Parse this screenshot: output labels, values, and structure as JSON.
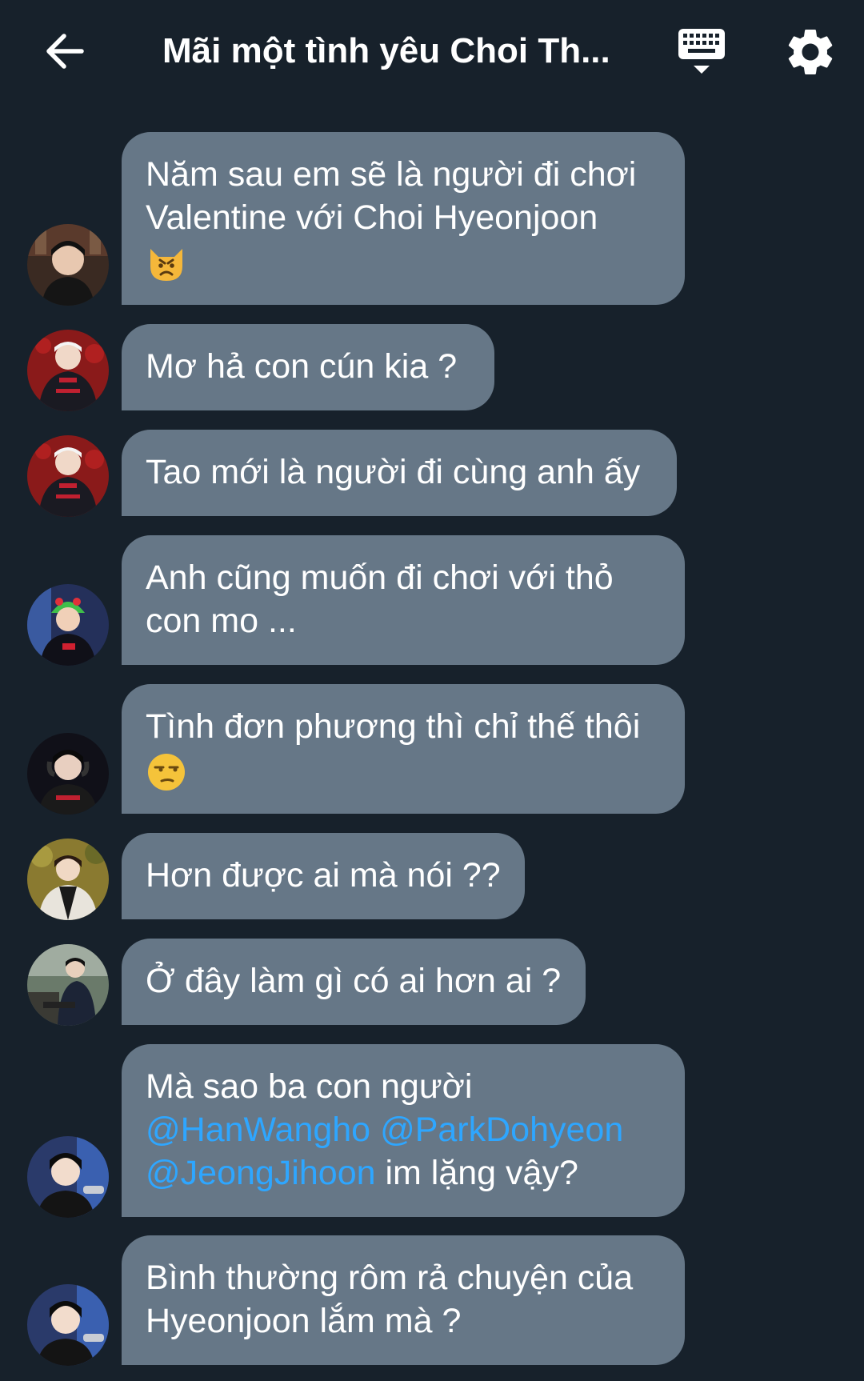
{
  "header": {
    "title": "Mãi một tình yêu Choi Th...",
    "icons": {
      "back": "arrow-left-icon",
      "keyboard": "keyboard-icon",
      "settings": "gear-icon"
    }
  },
  "colors": {
    "background": "#17212b",
    "bubble": "#667787",
    "mention": "#2ea6ff",
    "text": "#ffffff"
  },
  "messages": [
    {
      "text_1": "Năm sau em sẽ là người đi chơi",
      "text_2": "Valentine với Choi Hyeonjoon",
      "emoji": "pouting-cat-emoji"
    },
    {
      "text": "Mơ hả con cún kia ?"
    },
    {
      "text": "Tao mới là người đi cùng anh ấy"
    },
    {
      "text_1": "Anh cũng muốn đi chơi với thỏ",
      "text_2": "con mo ..."
    },
    {
      "text": "Tình đơn phương thì chỉ thế thôi",
      "emoji": "unamused-face-emoji"
    },
    {
      "text": "Hơn được ai mà nói ??"
    },
    {
      "text": "Ở đây làm gì có ai hơn ai ?"
    },
    {
      "text_1": "Mà sao ba con người",
      "mention_1": "@HanWangho",
      "mention_2": "@ParkDohyeon",
      "mention_3": "@JeongJihoon",
      "text_2": " im lặng vậy?"
    },
    {
      "text_1": "Bình thường rôm rả chuyện của",
      "text_2": "Hyeonjoon lắm mà ?"
    }
  ]
}
